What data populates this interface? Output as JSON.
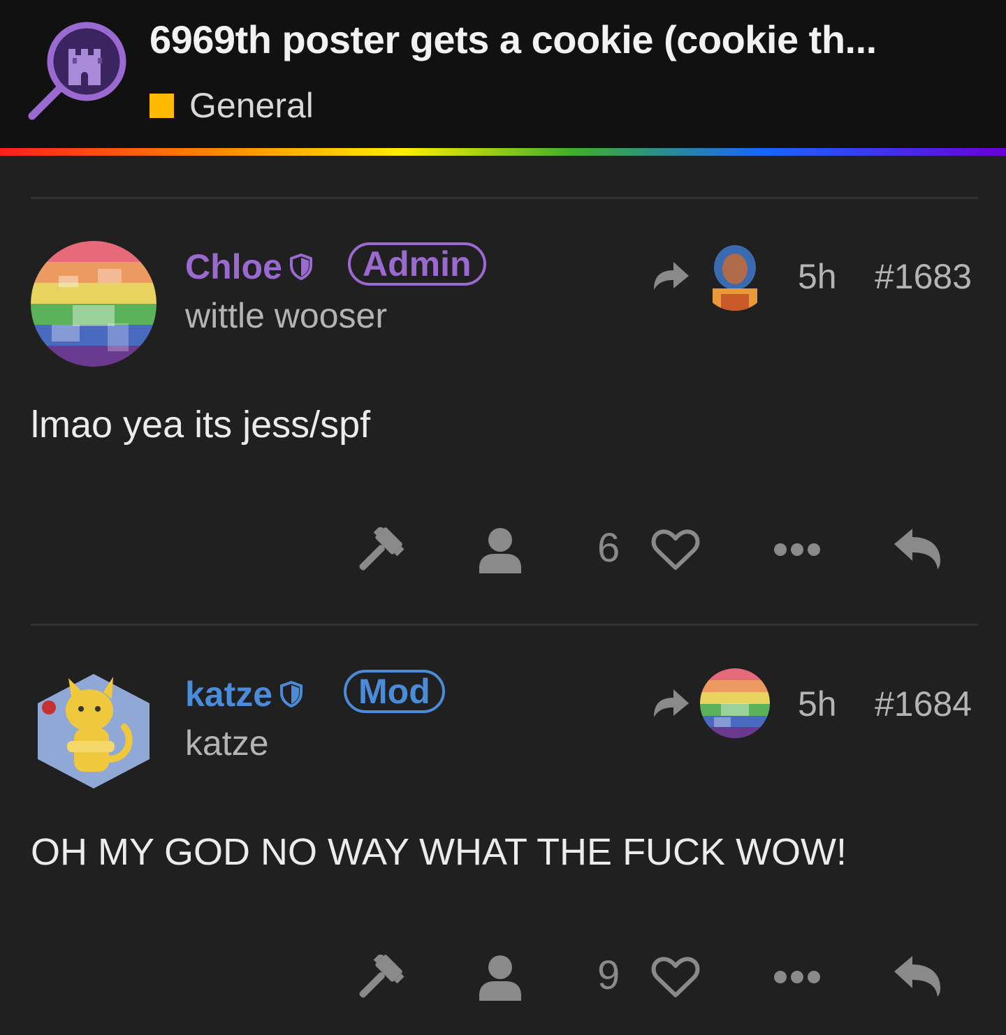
{
  "header": {
    "topic_title": "6969th poster gets a cookie (cookie th...",
    "category": {
      "name": "General",
      "color": "#ffb900"
    }
  },
  "posts": [
    {
      "username": "Chloe",
      "role": "Admin",
      "role_color": "#9b6ad0",
      "user_title": "wittle wooser",
      "time": "5h",
      "number": "#1683",
      "body": "lmao yea its jess/spf",
      "like_count": "6"
    },
    {
      "username": "katze",
      "role": "Mod",
      "role_color": "#4a8cd9",
      "user_title": "katze",
      "time": "5h",
      "number": "#1684",
      "body": "OH MY GOD NO WAY WHAT THE FUCK WOW!",
      "like_count": "9"
    }
  ],
  "icons": {
    "logo": "castle-magnifier-icon",
    "share": "share-arrow-icon",
    "moderate": "gavel-icon",
    "user": "user-icon",
    "like": "heart-icon",
    "more": "ellipsis-icon",
    "reply": "reply-icon",
    "badge": "shield-icon"
  }
}
